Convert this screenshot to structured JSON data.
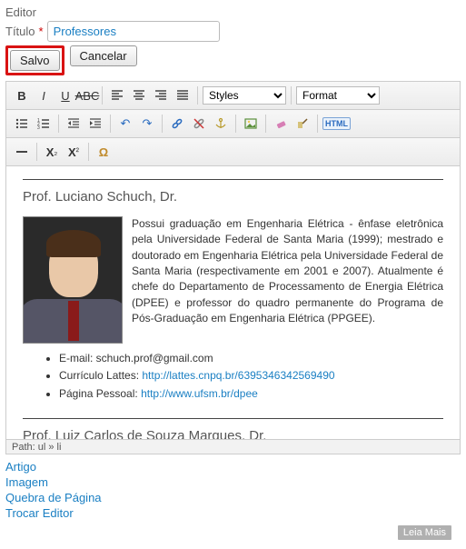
{
  "header": {
    "editor_label": "Editor",
    "title_label": "Título",
    "required_mark": "*",
    "title_value": "Professores"
  },
  "buttons": {
    "save": "Salvo",
    "cancel": "Cancelar"
  },
  "toolbar": {
    "styles_label": "Styles",
    "format_label": "Format"
  },
  "content": {
    "prof1_name": "Prof. Luciano Schuch, Dr.",
    "prof1_bio": "Possui graduação em Engenharia Elétrica - ênfase eletrônica pela Universidade Federal de Santa Maria (1999); mestrado e doutorado em Engenharia Elétrica pela Universidade Federal de Santa Maria (respectivamente em 2001 e 2007). Atualmente é chefe do Departamento de Processamento de Energia Elétrica (DPEE) e professor do quadro permanente do Programa de Pós-Graduação em Engenharia Elétrica (PPGEE).",
    "email_label": "E-mail: ",
    "email_value": "schuch.prof@gmail.com",
    "lattes_label": "Currículo Lattes: ",
    "lattes_url": "http://lattes.cnpq.br/6395346342569490",
    "page_label": "Página Pessoal: ",
    "page_url": "http://www.ufsm.br/dpee",
    "prof2_name": "Prof. Luiz Carlos de Souza Marques, Dr."
  },
  "status": {
    "path": "Path: ul » li"
  },
  "footer": {
    "links": [
      "Artigo",
      "Imagem",
      "Quebra de Página",
      "Trocar Editor"
    ],
    "read_more": "Leia Mais"
  }
}
